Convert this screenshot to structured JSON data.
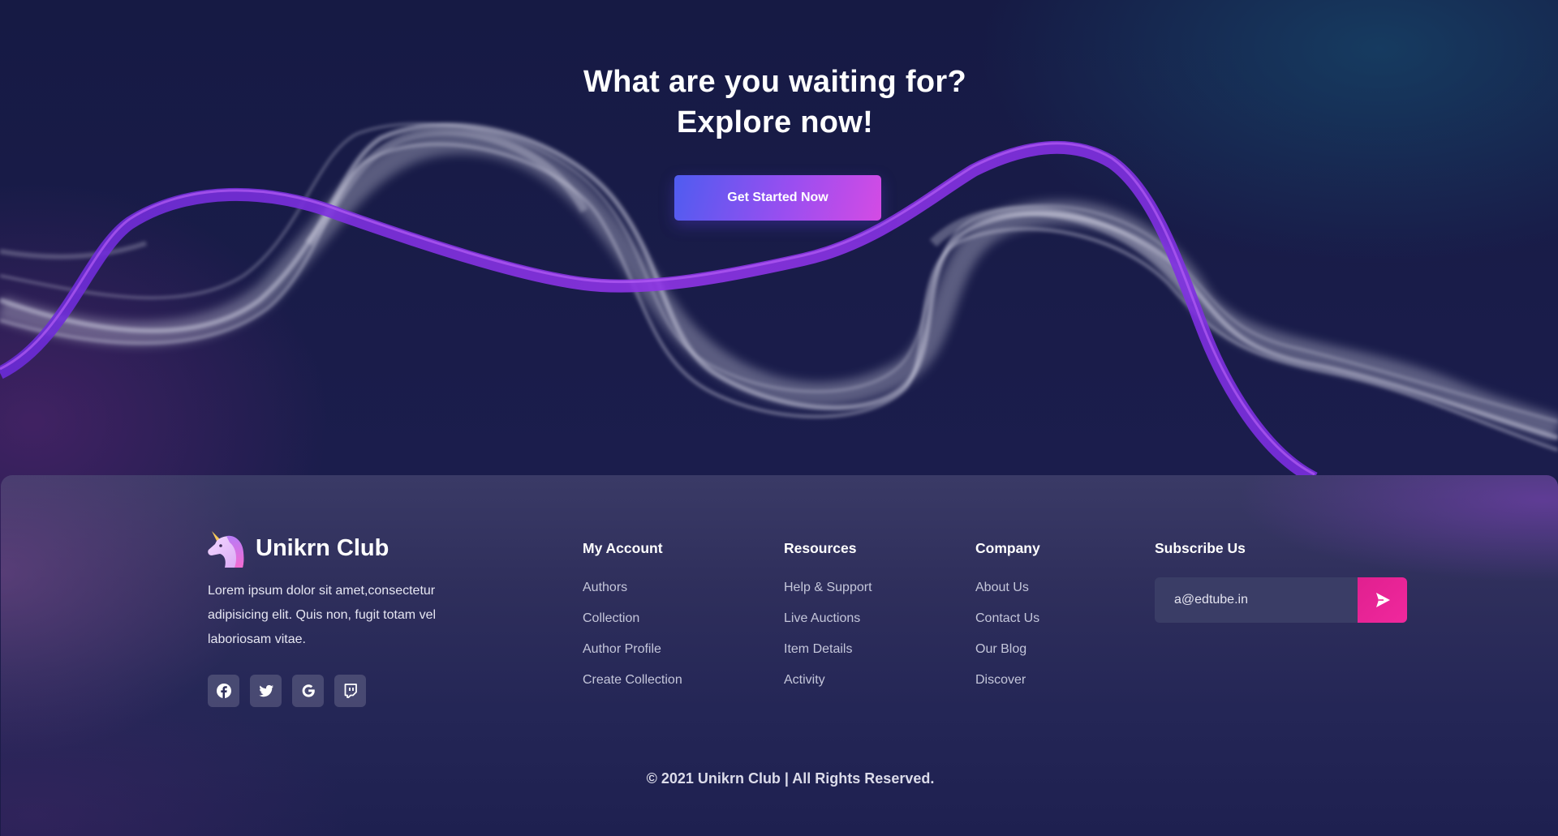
{
  "hero": {
    "title_line1": "What are you waiting for?",
    "title_line2": "Explore now!",
    "cta_label": "Get Started Now"
  },
  "footer": {
    "brand": {
      "name": "Unikrn Club",
      "logo_icon": "unicorn-icon",
      "description": "Lorem ipsum dolor sit amet,consectetur adipisicing elit. Quis non, fugit totam vel laboriosam vitae."
    },
    "socials": [
      {
        "name": "facebook-icon"
      },
      {
        "name": "twitter-icon"
      },
      {
        "name": "google-icon"
      },
      {
        "name": "twitch-icon"
      }
    ],
    "columns": {
      "account": {
        "title": "My Account",
        "items": [
          "Authors",
          "Collection",
          "Author Profile",
          "Create Collection"
        ]
      },
      "resources": {
        "title": "Resources",
        "items": [
          "Help & Support",
          "Live Auctions",
          "Item Details",
          "Activity"
        ]
      },
      "company": {
        "title": "Company",
        "items": [
          "About Us",
          "Contact Us",
          "Our Blog",
          "Discover"
        ]
      }
    },
    "subscribe": {
      "title": "Subscribe Us",
      "email_value": "a@edtube.in",
      "button_icon": "send-icon"
    },
    "copyright": "© 2021 Unikrn Club |  All Rights Reserved."
  },
  "colors": {
    "background": "#171c45",
    "accent_purple": "#9a4ef0",
    "accent_pink": "#e8238f",
    "footer_panel": "#2f2f5c",
    "ribbon_purple": "#8a2be2",
    "smoke": "#c9c9d9"
  }
}
